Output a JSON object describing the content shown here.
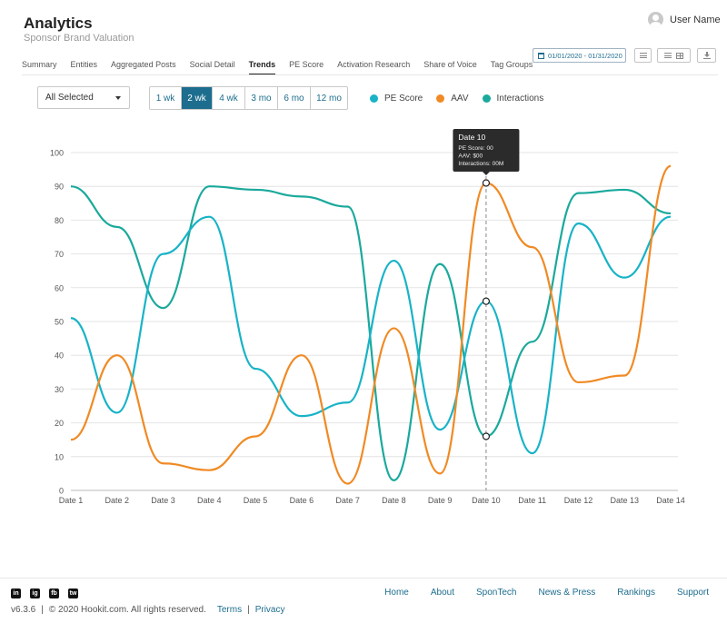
{
  "app": {
    "title": "Analytics",
    "subtitle": "Sponsor Brand Valuation"
  },
  "user": {
    "name": "User Name",
    "icon": "user-avatar-icon"
  },
  "nav": {
    "tabs": [
      "Summary",
      "Entities",
      "Aggregated Posts",
      "Social Detail",
      "Trends",
      "PE Score",
      "Activation Research",
      "Share of Voice",
      "Tag Groups"
    ],
    "active": "Trends"
  },
  "toolbar": {
    "date_range": "01/01/2020 - 01/31/2020"
  },
  "filter": {
    "selected": "All Selected"
  },
  "ranges": {
    "buttons": [
      "1 wk",
      "2 wk",
      "4 wk",
      "3 mo",
      "6 mo",
      "12 mo"
    ],
    "active": "2 wk"
  },
  "legend": [
    {
      "label": "PE Score",
      "color": "#18b3c7"
    },
    {
      "label": "AAV",
      "color": "#f08a24"
    },
    {
      "label": "Interactions",
      "color": "#1aa99c"
    }
  ],
  "chart_data": {
    "type": "line",
    "x": [
      "Date 1",
      "Date 2",
      "Date 3",
      "Date 4",
      "Date 5",
      "Date 6",
      "Date 7",
      "Date 8",
      "Date 9",
      "Date 10",
      "Date 11",
      "Date 12",
      "Date 13",
      "Date 14"
    ],
    "ylim": [
      0,
      100
    ],
    "yticks": [
      0,
      10,
      20,
      30,
      40,
      50,
      60,
      70,
      80,
      90,
      100
    ],
    "grid": true,
    "series": [
      {
        "name": "PE Score",
        "color": "#18b3c7",
        "values": [
          51,
          23,
          70,
          81,
          36,
          22,
          26,
          68,
          18,
          56,
          11,
          79,
          63,
          81
        ]
      },
      {
        "name": "AAV",
        "color": "#f08a24",
        "values": [
          15,
          40,
          8,
          6,
          16,
          40,
          2,
          48,
          5,
          91,
          72,
          32,
          34,
          96
        ]
      },
      {
        "name": "Interactions",
        "color": "#1aa99c",
        "values": [
          90,
          78,
          54,
          90,
          89,
          87,
          84,
          3,
          67,
          16,
          44,
          88,
          89,
          82
        ]
      }
    ],
    "tooltip": {
      "x_index": 9,
      "title": "Date 10",
      "lines": [
        "PE Score:  00",
        "AAV:  $00",
        "Interactions:  00M"
      ]
    }
  },
  "footer": {
    "social": [
      "in",
      "ig",
      "fb",
      "tw"
    ],
    "links": [
      "Home",
      "About",
      "SponTech",
      "News & Press",
      "Rankings",
      "Support"
    ],
    "version": "v6.3.6",
    "copyright": "© 2020 Hookit.com. All rights reserved.",
    "terms": "Terms",
    "privacy": "Privacy"
  }
}
